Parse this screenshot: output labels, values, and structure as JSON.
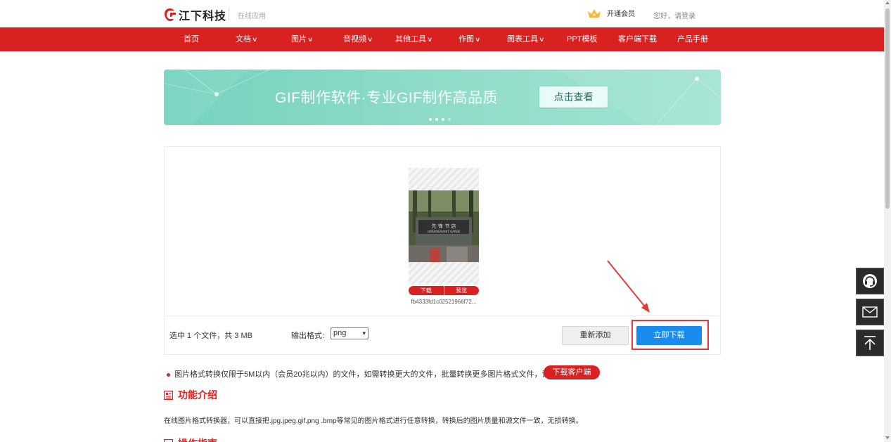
{
  "header": {
    "brand": "江下科技",
    "sub_label": "在线应用",
    "vip_label": "开通会员",
    "login_label": "您好，请登录"
  },
  "nav": {
    "items": [
      {
        "label": "首页",
        "dropdown": false
      },
      {
        "label": "文档",
        "dropdown": true
      },
      {
        "label": "图片",
        "dropdown": true
      },
      {
        "label": "音视频",
        "dropdown": true
      },
      {
        "label": "其他工具",
        "dropdown": true
      },
      {
        "label": "作图",
        "dropdown": true
      },
      {
        "label": "图表工具",
        "dropdown": true
      },
      {
        "label": "PPT模板",
        "dropdown": false
      },
      {
        "label": "客户端下载",
        "dropdown": false
      },
      {
        "label": "产品手册",
        "dropdown": false
      }
    ]
  },
  "banner": {
    "title": "GIF制作软件·专业GIF制作高品质",
    "button_label": "点击查看",
    "slide_count": 4,
    "active_slide": 1
  },
  "file_card": {
    "download_label": "下载",
    "preview_label": "预览",
    "filename": "fb4333fd1c02521966f72...",
    "photo_sign_text": "LIBRARIEAVANT GARDE",
    "photo_sign_cn": "先 锋 书 店"
  },
  "toolbar": {
    "selection_info": "选中 1 个文件，共 3 MB",
    "format_label": "输出格式:",
    "format_value": "png",
    "readd_label": "重新添加",
    "download_now_label": "立即下载"
  },
  "notice": {
    "text": "图片格式转换仅限于5M以内（会员20兆以内）的文件，如需转换更大的文件，批量转换更多图片格式文件，请",
    "client_button": "下载客户端"
  },
  "sections": {
    "intro_title": "功能介绍",
    "intro_text": "在线图片格式转换器，可以直接把.jpg.jpeg.gif.png .bmp等常见的图片格式进行任意转换，转换后的图片质量和源文件一致，无损转换。",
    "guide_title": "操作指南"
  },
  "colors": {
    "brand_red": "#d92121",
    "primary_blue": "#1a8cf0",
    "banner_teal": "#8fdcc9"
  },
  "side_tools": [
    "headset-icon",
    "mail-icon",
    "back-to-top-icon"
  ]
}
